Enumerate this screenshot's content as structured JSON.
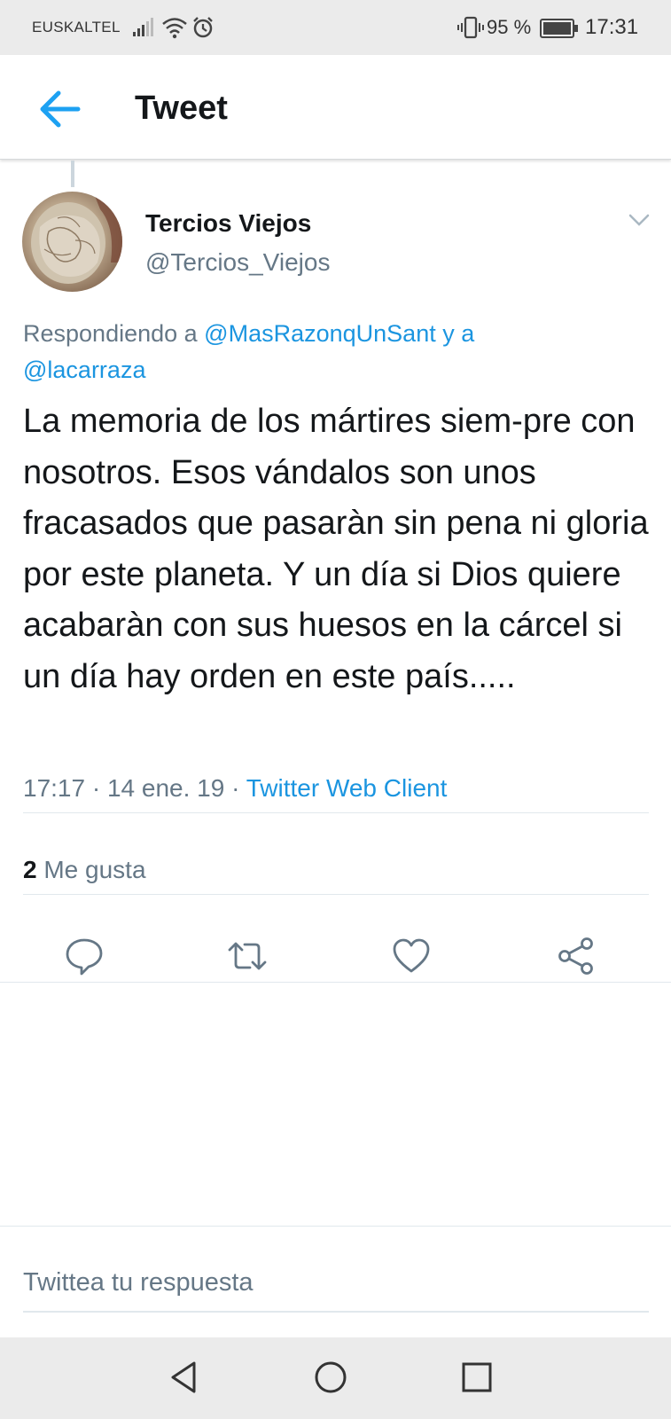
{
  "status_bar": {
    "carrier": "EUSKALTEL",
    "battery_percent": "95 %",
    "time": "17:31",
    "icons": [
      "signal-icon",
      "wifi-icon",
      "alarm-icon",
      "vibrate-icon",
      "battery-icon"
    ]
  },
  "header": {
    "title": "Tweet",
    "back_icon": "arrow-left-icon"
  },
  "tweet": {
    "author": {
      "display_name": "Tercios Viejos",
      "handle": "@Tercios_Viejos"
    },
    "reply_prefix": "Respondiendo a ",
    "reply_mention_1": "@MasRazonqUnSant",
    "reply_join": " y a ",
    "reply_mention_2": "@lacarraza",
    "text": "La memoria de los mártires siem-pre con nosotros. Esos vándalos son unos fracasados que pasaràn sin pena ni gloria por este planeta. Y un día si Dios quiere acabaràn con sus huesos en la cárcel si un día hay orden en este país.....",
    "time": "17:17",
    "date": "14 ene. 19",
    "separator": " · ",
    "client": "Twitter Web Client",
    "likes_count": "2",
    "likes_label": " Me gusta"
  },
  "actions": [
    "reply-icon",
    "retweet-icon",
    "like-icon",
    "share-icon"
  ],
  "composer": {
    "placeholder": "Twittea tu respuesta"
  },
  "nav": [
    "back-triangle-icon",
    "home-circle-icon",
    "recents-square-icon"
  ],
  "colors": {
    "accent": "#1b95e0",
    "secondary_text": "#657786",
    "primary_text": "#14171a",
    "system_bar": "#ebebeb"
  }
}
